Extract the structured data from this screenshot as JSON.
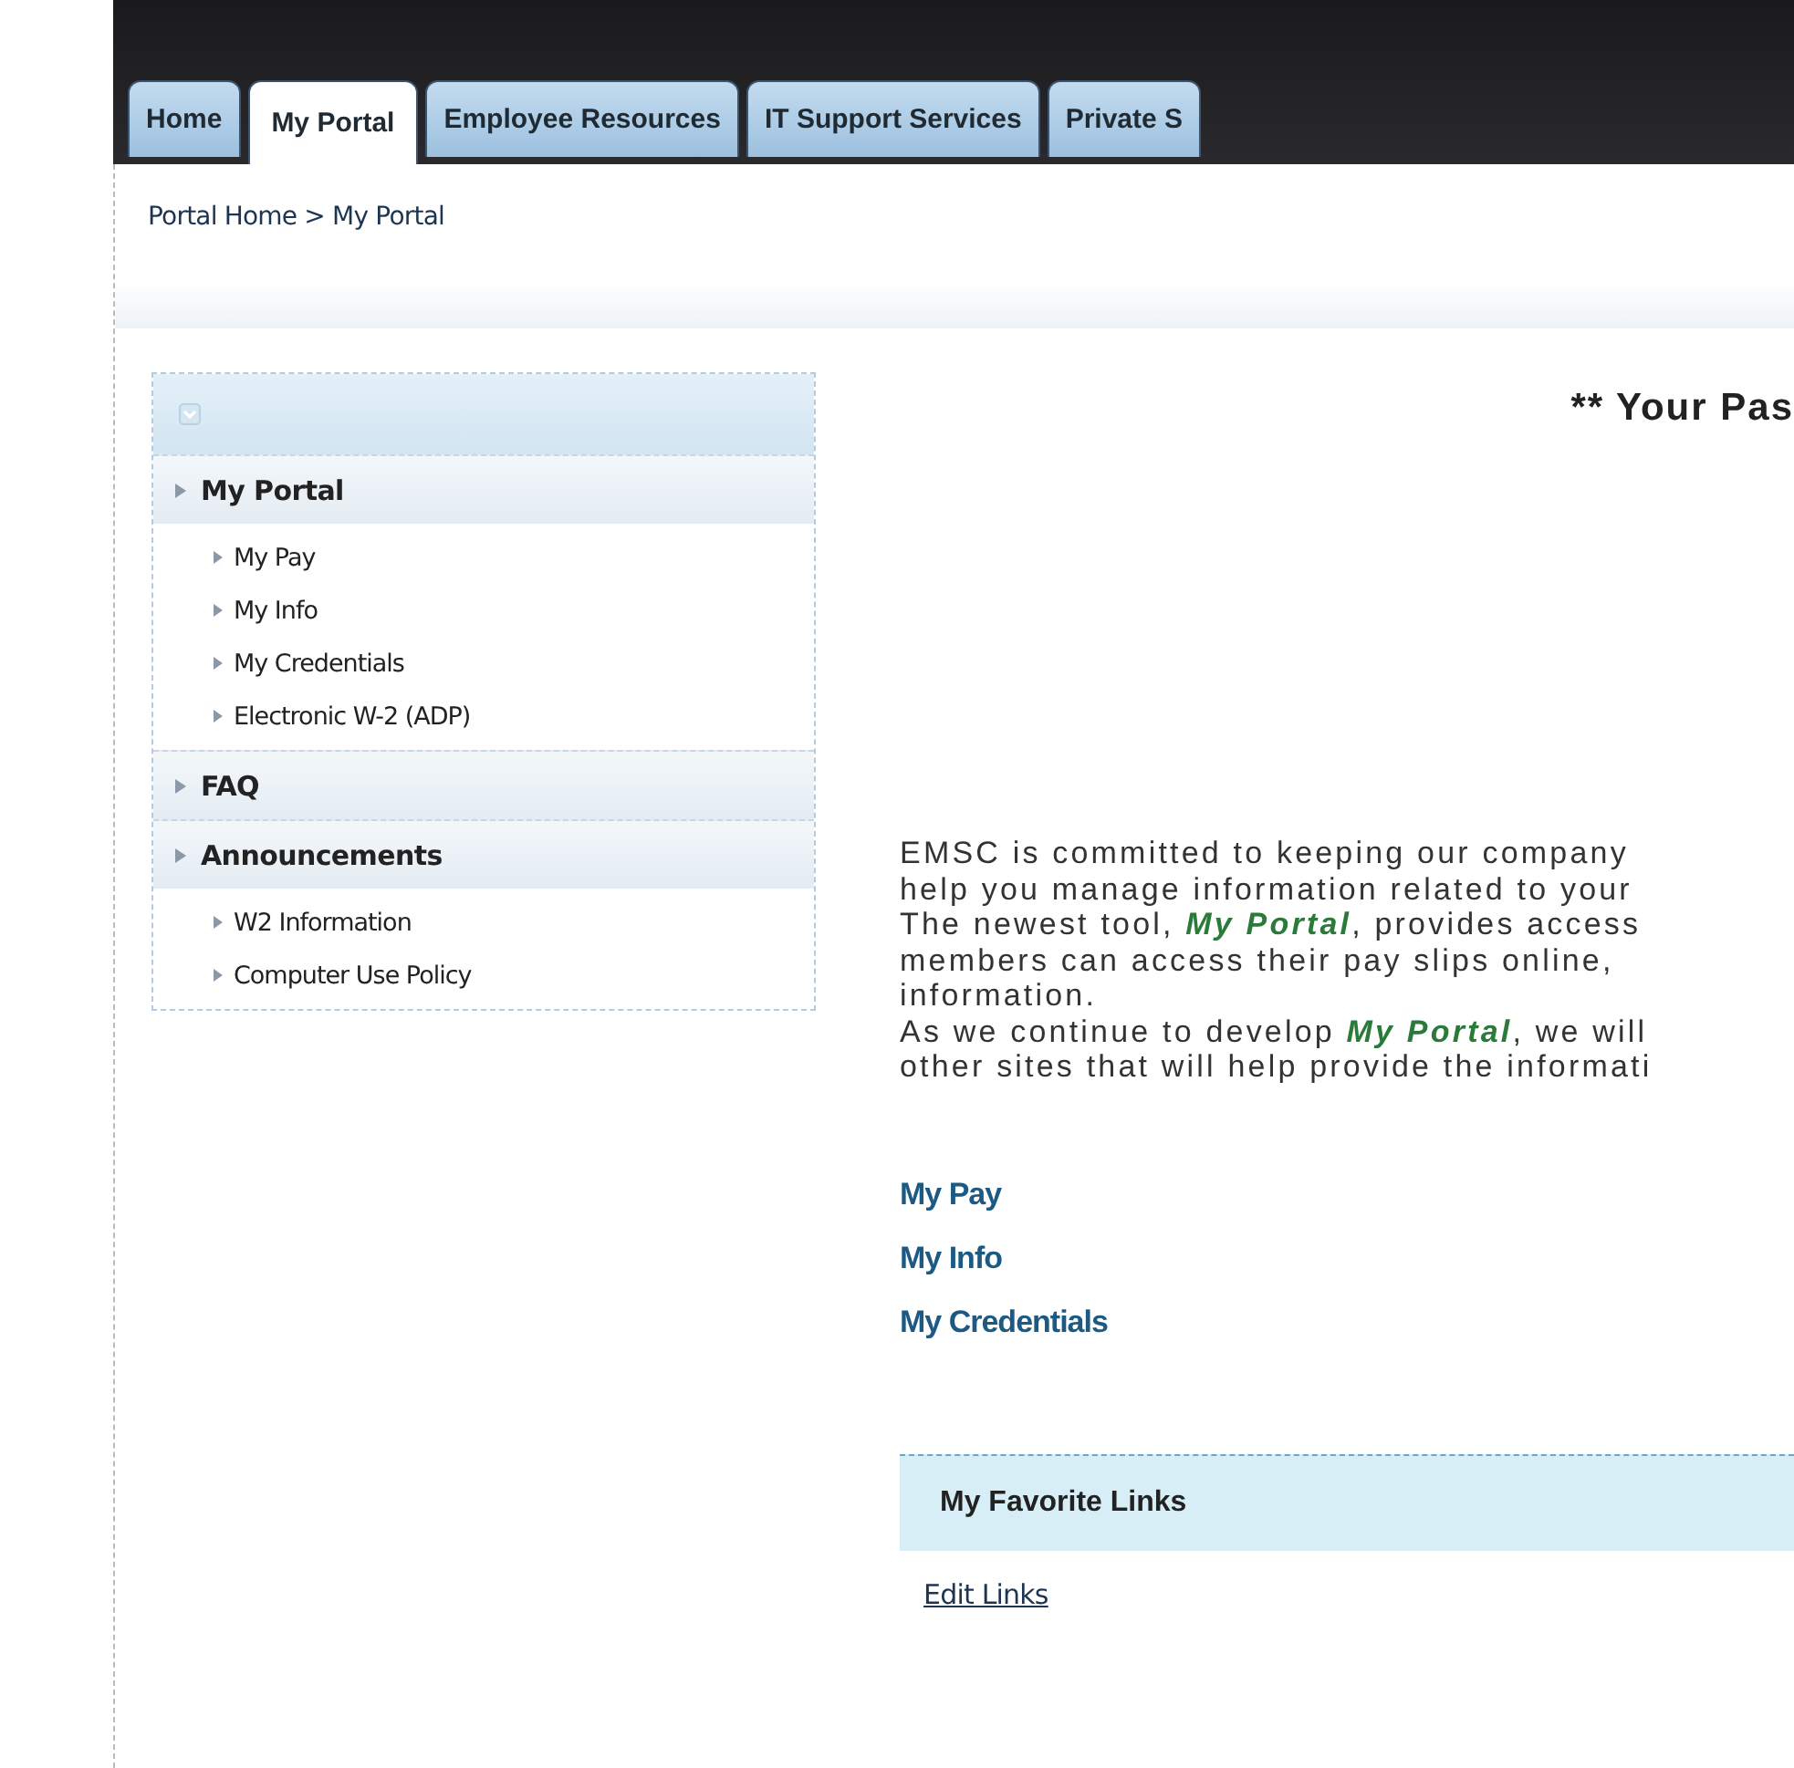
{
  "tabs": [
    {
      "label": "Home",
      "selected": false
    },
    {
      "label": "My Portal",
      "selected": true
    },
    {
      "label": "Employee Resources",
      "selected": false
    },
    {
      "label": "IT Support Services",
      "selected": false
    },
    {
      "label": "Private S",
      "selected": false
    }
  ],
  "breadcrumb": "Portal Home > My Portal",
  "sidebar": {
    "sections": [
      {
        "label": "My Portal",
        "items": [
          "My Pay",
          "My Info",
          "My Credentials",
          "Electronic W-2 (ADP)"
        ]
      },
      {
        "label": "FAQ"
      },
      {
        "label": "Announcements",
        "items": [
          "W2 Information",
          "Computer Use Policy"
        ]
      }
    ]
  },
  "heading": "** Your Pas",
  "intro_lines": [
    [
      {
        "text": "EMSC is committed to keeping our company"
      }
    ],
    [
      {
        "text": "help you manage information related to your"
      }
    ],
    [
      {
        "text": "The newest tool, "
      },
      {
        "text": "My Portal",
        "emphasis": true
      },
      {
        "text": ", provides access"
      }
    ],
    [
      {
        "text": "members can access their pay slips online,"
      }
    ],
    [
      {
        "text": "information."
      }
    ],
    [
      {
        "text": "As we continue to develop "
      },
      {
        "text": "My Portal",
        "emphasis": true
      },
      {
        "text": ", we will"
      }
    ],
    [
      {
        "text": "other sites that will help provide the informati"
      }
    ]
  ],
  "quick_links": [
    "My Pay",
    "My Info",
    "My Credentials"
  ],
  "favorites": {
    "title": "My Favorite Links",
    "link": "Edit Links"
  }
}
